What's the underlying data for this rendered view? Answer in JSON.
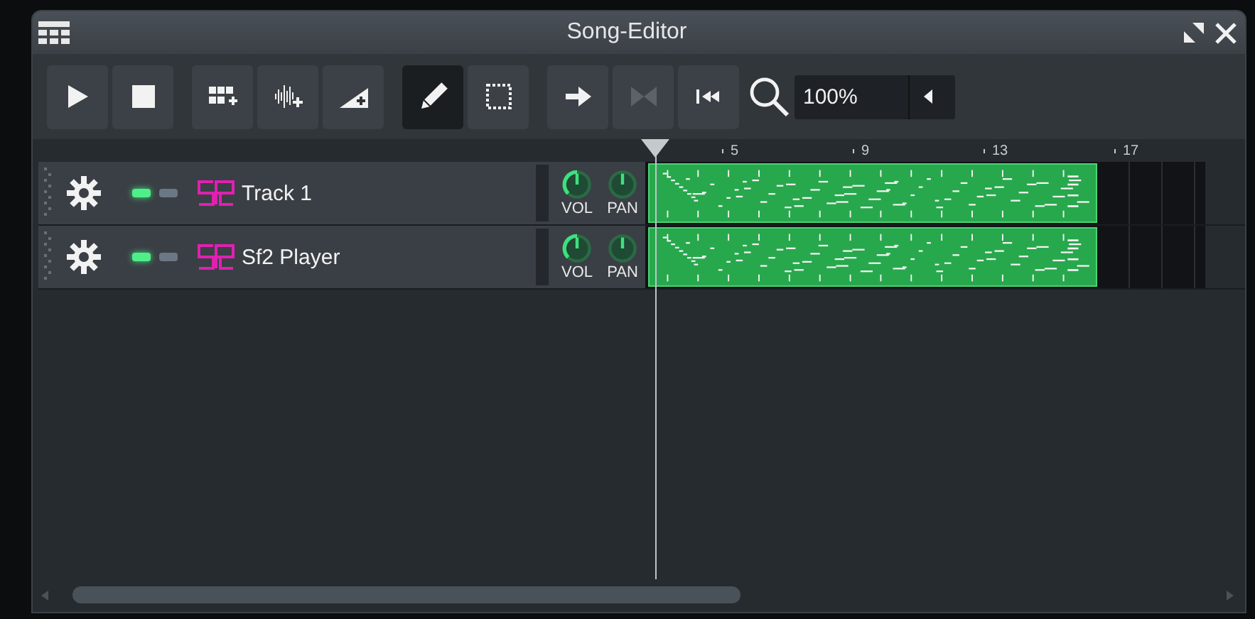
{
  "window": {
    "title": "Song-Editor"
  },
  "toolbar": {
    "buttons": [
      {
        "kind": "play",
        "selected": false,
        "disabled": false
      },
      {
        "kind": "stop",
        "selected": false,
        "disabled": false
      },
      {
        "kind": "add-beat",
        "selected": false,
        "disabled": false
      },
      {
        "kind": "add-sample",
        "selected": false,
        "disabled": false
      },
      {
        "kind": "add-automation",
        "selected": false,
        "disabled": false
      },
      {
        "kind": "draw",
        "selected": true,
        "disabled": false
      },
      {
        "kind": "select",
        "selected": false,
        "disabled": false
      },
      {
        "kind": "follow",
        "selected": false,
        "disabled": false
      },
      {
        "kind": "loop",
        "selected": false,
        "disabled": true
      },
      {
        "kind": "rewind",
        "selected": false,
        "disabled": false
      }
    ],
    "zoom": {
      "value": "100%"
    }
  },
  "ruler": {
    "labels": [
      "5",
      "9",
      "13",
      "17"
    ]
  },
  "tracks": [
    {
      "name": "Track 1",
      "muted": false,
      "solo": false,
      "knobs": [
        {
          "label": "VOL"
        },
        {
          "label": "PAN"
        }
      ]
    },
    {
      "name": "Sf2 Player",
      "muted": false,
      "solo": false,
      "knobs": [
        {
          "label": "VOL"
        },
        {
          "label": "PAN"
        }
      ]
    }
  ]
}
